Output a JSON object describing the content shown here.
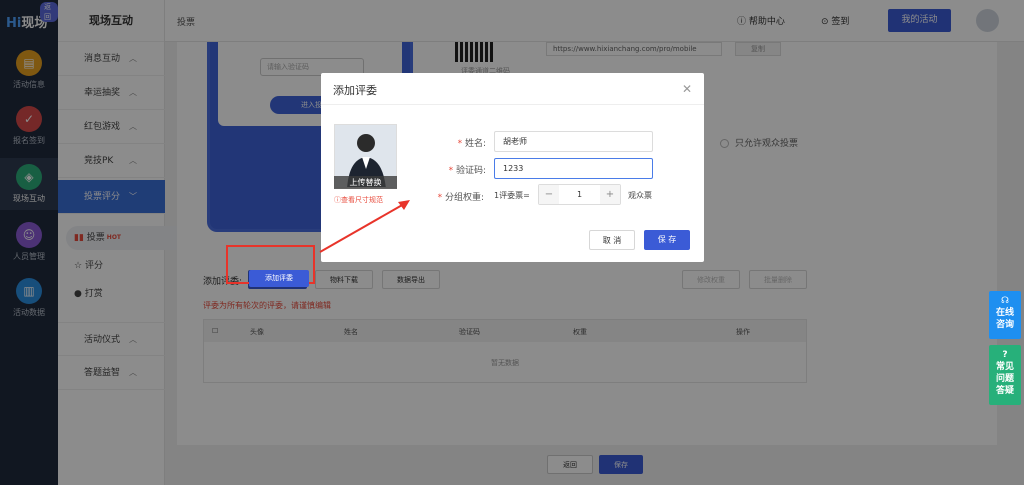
{
  "rail": {
    "logo": "现场",
    "logo_badge": "返回",
    "items": [
      {
        "label": "活动信息",
        "icon": "doc-icon",
        "color": "#e7a020"
      },
      {
        "label": "报名签到",
        "icon": "clipboard-icon",
        "color": "#d64a4a"
      },
      {
        "label": "现场互动",
        "icon": "interaction-icon",
        "color": "#2cae7a"
      },
      {
        "label": "人员管理",
        "icon": "person-icon",
        "color": "#8b5cd6"
      },
      {
        "label": "活动数据",
        "icon": "chart-icon",
        "color": "#2b8fe0"
      }
    ]
  },
  "sidebar": {
    "title": "现场互动",
    "menus": [
      "消息互动",
      "幸运抽奖",
      "红包游戏",
      "竞技PK",
      "投票评分",
      "活动仪式",
      "答题益智"
    ],
    "subs": [
      {
        "label": "投票",
        "badge": "HOT"
      },
      {
        "label": "评分"
      },
      {
        "label": "打赏"
      }
    ]
  },
  "header": {
    "breadcrumb": "投票",
    "help": "帮助中心",
    "signin": "签到",
    "my_activity": "我的活动"
  },
  "content": {
    "phone_input_placeholder": "请输入验证码",
    "phone_button": "进入投票",
    "qr_label": "评委通道二维码",
    "url": "https://www.hixianchang.com/pro/mobile",
    "copy": "复制",
    "audience_only": "只允许观众投票",
    "add_judge_label": "添加评委:",
    "add_judge_btn": "添加评委",
    "download_btn": "物料下载",
    "export_btn": "数据导出",
    "edit_weight_btn": "修改权重",
    "batch_delete_btn": "批量删除",
    "warning": "评委为所有轮次的评委，请谨慎编辑",
    "table_headers": [
      "头像",
      "姓名",
      "验证码",
      "权重",
      "操作"
    ],
    "empty": "暂无数据",
    "back_btn": "返回",
    "save_btn": "保存"
  },
  "dialog": {
    "title": "添加评委",
    "upload": "上传替换",
    "size_link": "查看尺寸规范",
    "name_label": "姓名:",
    "name_value": "胡老师",
    "code_label": "验证码:",
    "code_value": "1233",
    "weight_label": "分组权重:",
    "weight_prefix": "1评委票=",
    "weight_value": "1",
    "weight_suffix": "观众票",
    "cancel": "取 消",
    "save": "保 存"
  },
  "float": {
    "consult": "在线咨询",
    "faq": "常见问题答疑"
  },
  "colors": {
    "primary": "#3b5bd6",
    "danger": "#e84b3c"
  }
}
